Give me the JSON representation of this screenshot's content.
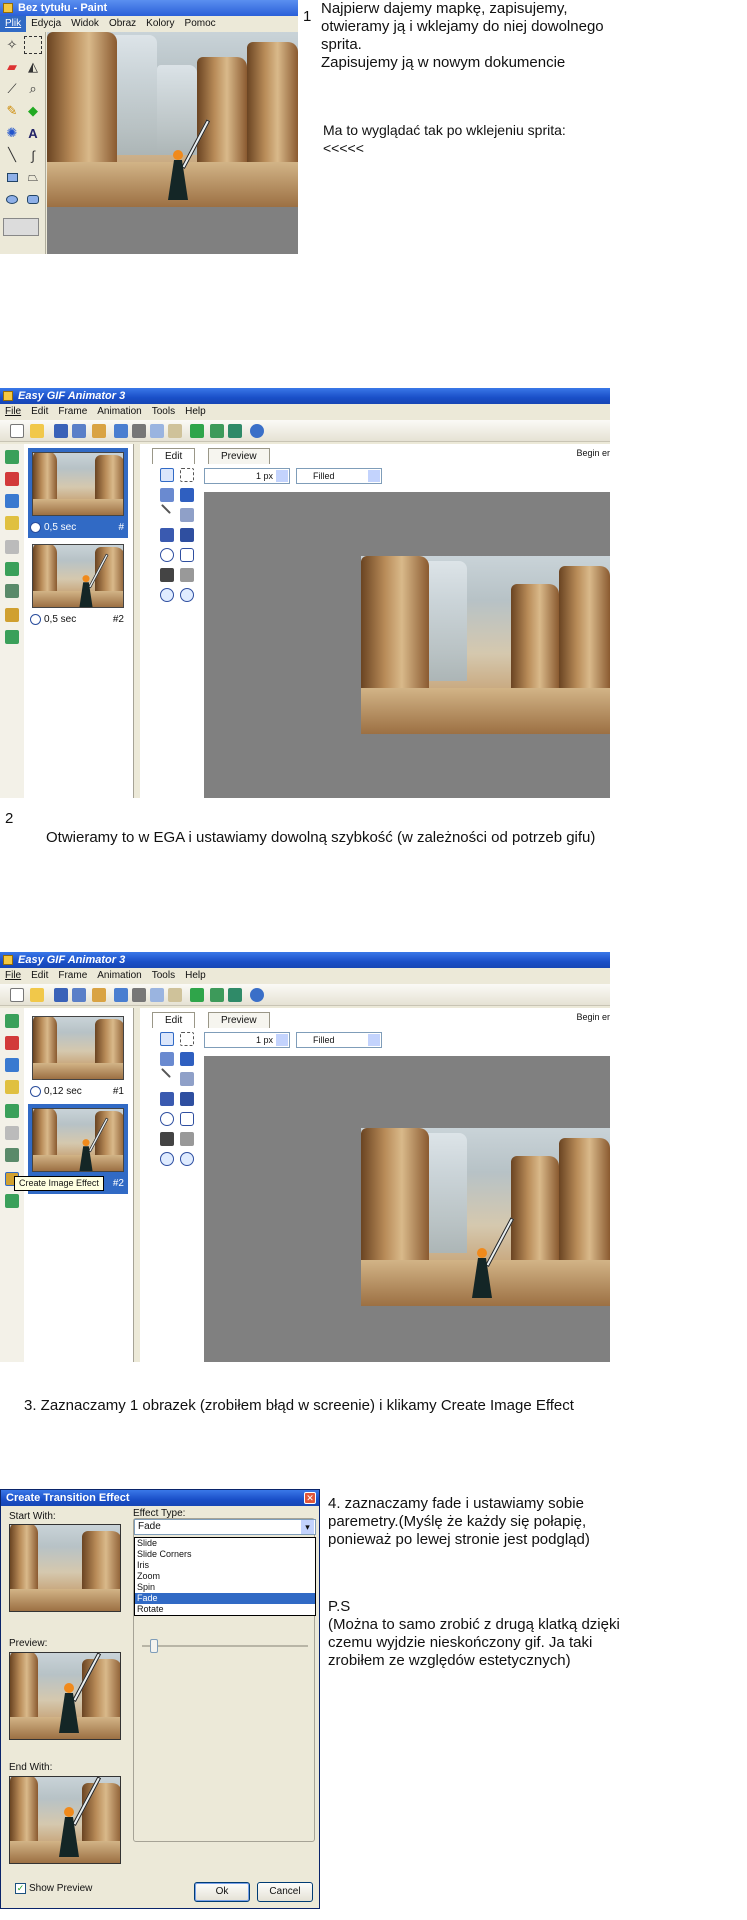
{
  "paint": {
    "title": "Bez tytułu - Paint",
    "menu": [
      "Plik",
      "Edycja",
      "Widok",
      "Obraz",
      "Kolory",
      "Pomoc"
    ]
  },
  "step1": {
    "number": "1",
    "text_lines": [
      "Najpierw dajemy mapkę, zapisujemy,",
      "otwieramy ją i wklejamy do niej dowolnego",
      "sprita.",
      "Zapisujemy ją w nowym dokumencie"
    ],
    "note_lines": [
      "Ma to wyglądać tak po wklejeniu sprita:",
      "<<<<<"
    ]
  },
  "ega1": {
    "title": "Easy GIF Animator 3",
    "menu": [
      "File",
      "Edit",
      "Frame",
      "Animation",
      "Tools",
      "Help"
    ],
    "tabs": [
      "Edit",
      "Preview"
    ],
    "begin_label": "Begin er",
    "line_width": "1 px",
    "fill_mode": "Filled",
    "frames": [
      {
        "delay": "0,5 sec",
        "number": "#",
        "selected": true
      },
      {
        "delay": "0,5 sec",
        "number": "#2",
        "selected": false
      }
    ]
  },
  "step2": {
    "number": "2",
    "text": "Otwieramy to w EGA i ustawiamy dowolną szybkość (w zależności od potrzeb gifu)"
  },
  "ega2": {
    "title": "Easy GIF Animator 3",
    "menu": [
      "File",
      "Edit",
      "Frame",
      "Animation",
      "Tools",
      "Help"
    ],
    "tabs": [
      "Edit",
      "Preview"
    ],
    "begin_label": "Begin er",
    "line_width": "1 px",
    "fill_mode": "Filled",
    "tooltip": "Create Image Effect",
    "frames": [
      {
        "delay": "0,12 sec",
        "number": "#1",
        "selected": false
      },
      {
        "delay": "",
        "number": "#2",
        "selected": true
      }
    ]
  },
  "step3": {
    "text": "3. Zaznaczamy 1 obrazek (zrobiłem błąd w screenie) i klikamy Create Image Effect"
  },
  "dialog": {
    "title": "Create Transition Effect",
    "start_label": "Start With:",
    "preview_label": "Preview:",
    "end_label": "End With:",
    "effect_label": "Effect Type:",
    "effect_value": "Fade",
    "effect_options": [
      "Slide",
      "Slide Corners",
      "Iris",
      "Zoom",
      "Spin",
      "Fade",
      "Rotate"
    ],
    "selected_option": "Fade",
    "show_preview": "Show Preview",
    "ok": "Ok",
    "cancel": "Cancel"
  },
  "step4": {
    "text_lines": [
      "4. zaznaczamy fade i ustawiamy sobie",
      "paremetry.(Myślę że każdy się połapię,",
      "ponieważ po lewej stronie jest podgląd)"
    ],
    "ps_title": "P.S",
    "ps_lines": [
      "(Można to samo zrobić z drugą klatką dzięki",
      "czemu wyjdzie nieskończony gif. Ja taki",
      "zrobiłem ze względów estetycznych)"
    ]
  }
}
